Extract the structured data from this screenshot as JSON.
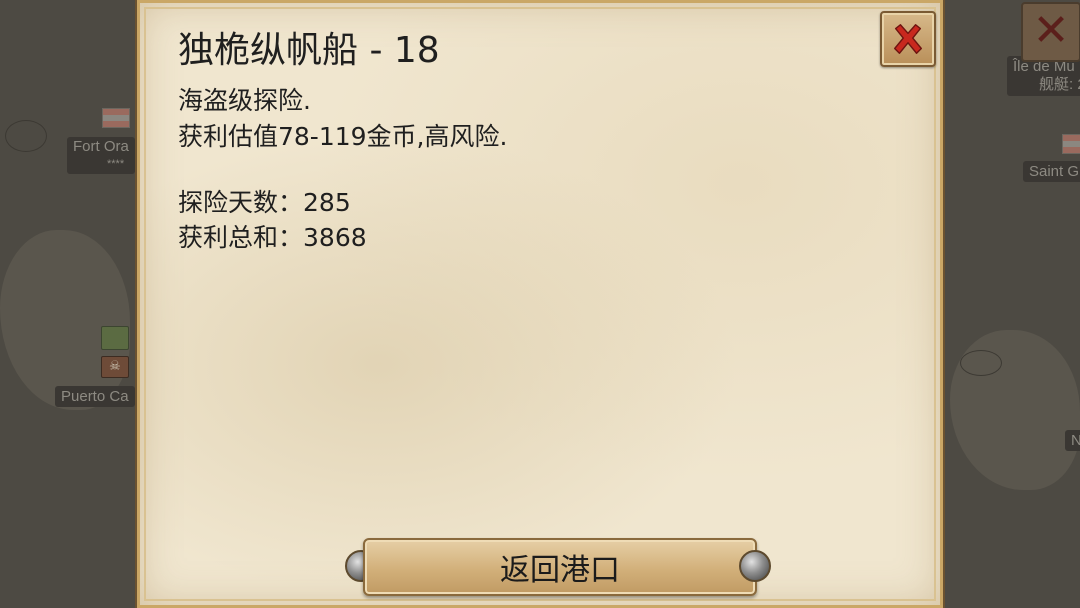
{
  "background_map": {
    "labels": {
      "fort": "Fort Ora",
      "fort_stars": "****",
      "puerto": "Puerto Ca",
      "ile": "Île de Mu",
      "ile_sub": "舰艇: 2",
      "saint": "Saint G",
      "n": "N"
    },
    "close_glyph": "✕"
  },
  "dialog": {
    "title": "独桅纵帆船 - 18",
    "description_line1": "海盗级探险.",
    "description_line2": "获利估值78-119金币,高风险.",
    "stats": {
      "days_label": "探险天数：",
      "days_value": "285",
      "profit_label": "获利总和：",
      "profit_value": "3868"
    },
    "return_button": "返回港口"
  },
  "colors": {
    "parchment": "#f0e6cf",
    "frame": "#caa766",
    "close_x": "#c8281e",
    "button": "#d2b07a"
  },
  "icons": {
    "close": "close-icon",
    "rivet": "rivet-icon"
  }
}
